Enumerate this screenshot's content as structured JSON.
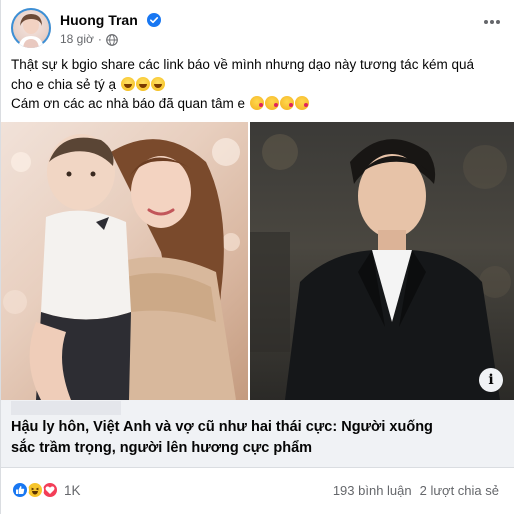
{
  "post": {
    "author": "Huong Tran",
    "time": "18 giờ",
    "lines": [
      "Thật sự k bgio share các link báo về mình nhưng dạo này tương tác kém quá",
      "cho e chia sẻ tý ạ",
      "Cám ơn các ac nhà báo đã quan tâm e"
    ]
  },
  "link_preview": {
    "title_line1": "Hậu ly hôn, Việt Anh và vợ cũ như hai thái cực: Người xuống",
    "title_line2": "sắc trầm trọng, người lên hương cực phẩm",
    "info_label": "i"
  },
  "stats": {
    "reaction_count": "1K",
    "comments": "193 bình luận",
    "shares": "2 lượt chia sẻ"
  },
  "icons": {
    "verified": "verified-badge-icon",
    "globe": "globe-icon",
    "more": "more-options-icon",
    "like": "like-reaction-icon",
    "haha": "haha-reaction-icon",
    "love": "love-reaction-icon"
  },
  "colors": {
    "accent": "#1877f2",
    "text_primary": "#050505",
    "text_secondary": "#65676b",
    "preview_bg": "#f0f2f5"
  }
}
